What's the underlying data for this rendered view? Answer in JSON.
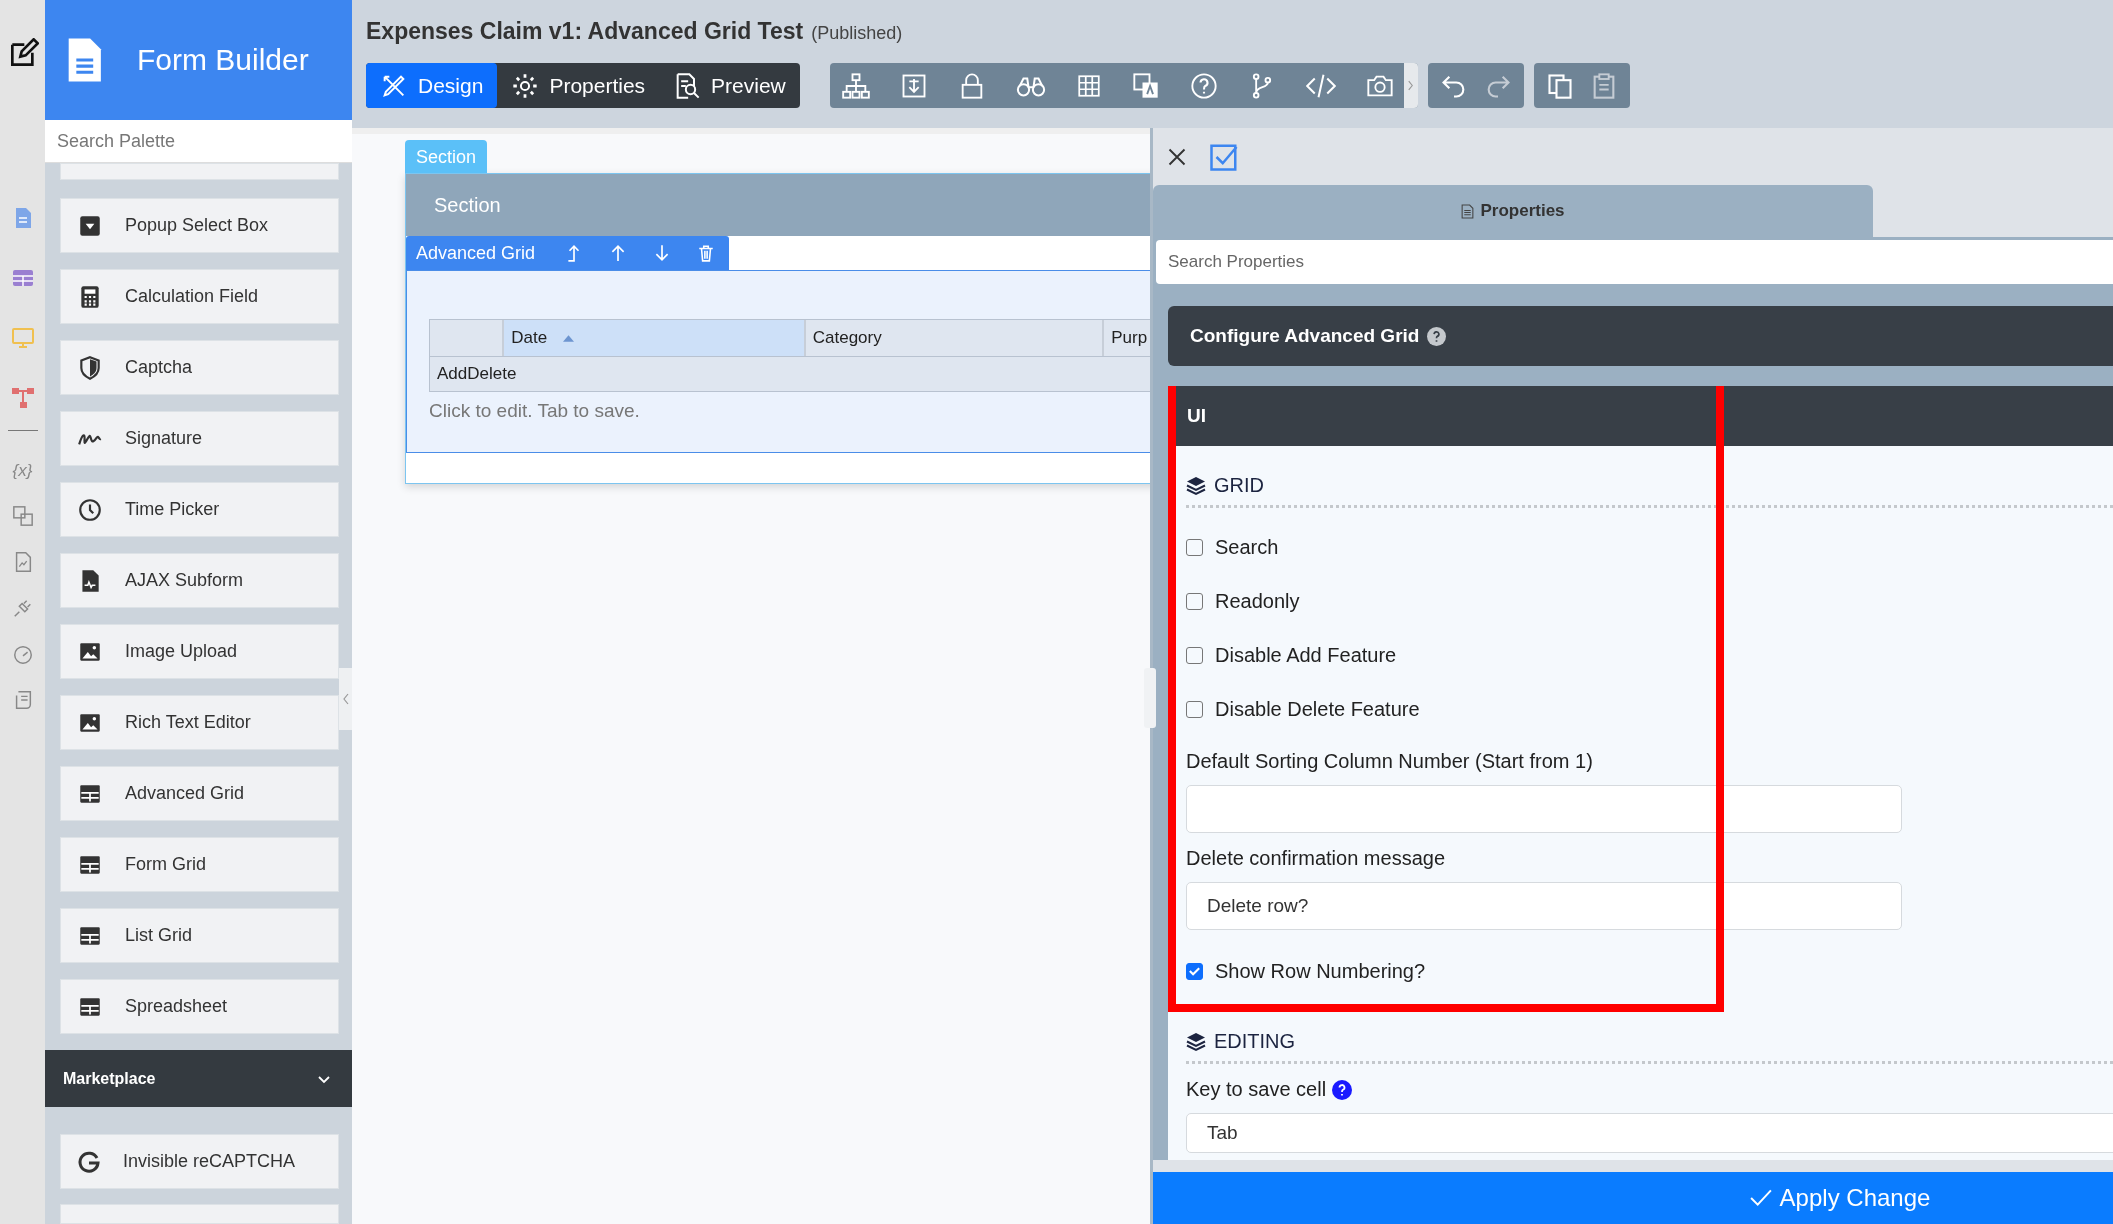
{
  "rail": {
    "variable_glyph": "{x}"
  },
  "palette": {
    "title": "Form Builder",
    "search": {
      "placeholder": "Search Palette"
    },
    "items": [
      {
        "label": "Popup Select Box"
      },
      {
        "label": "Calculation Field"
      },
      {
        "label": "Captcha"
      },
      {
        "label": "Signature"
      },
      {
        "label": "Time Picker"
      },
      {
        "label": "AJAX Subform"
      },
      {
        "label": "Image Upload"
      },
      {
        "label": "Rich Text Editor"
      },
      {
        "label": "Advanced Grid"
      },
      {
        "label": "Form Grid"
      },
      {
        "label": "List Grid"
      },
      {
        "label": "Spreadsheet"
      }
    ],
    "marketplace": {
      "label": "Marketplace",
      "expanded": true,
      "items": [
        {
          "label": "Invisible reCAPTCHA"
        }
      ]
    }
  },
  "header": {
    "title": "Expenses Claim v1: Advanced Grid Test",
    "status": "(Published)"
  },
  "modes": [
    {
      "label": "Design",
      "selected": true
    },
    {
      "label": "Properties",
      "selected": false
    },
    {
      "label": "Preview",
      "selected": false
    }
  ],
  "canvas": {
    "section_tab": "Section",
    "section_title": "Section",
    "element_label": "Advanced Grid",
    "grid": {
      "columns": [
        {
          "sorted": false
        },
        {
          "label": "Date",
          "sorted": true
        },
        {
          "label": "Category",
          "sorted": false
        },
        {
          "label": "Purp",
          "sorted": false
        }
      ],
      "row": "AddDelete",
      "hint": "Click to edit. Tab to save."
    }
  },
  "panel": {
    "tabs": [
      {
        "label": "Properties",
        "selected": true
      }
    ],
    "search": {
      "placeholder": "Search Properties"
    },
    "heading": "Configure Advanced Grid",
    "section": "UI",
    "groups": [
      {
        "title": "GRID",
        "highlighted": true,
        "fields": [
          {
            "kind": "checkbox",
            "label": "Search",
            "checked": false
          },
          {
            "kind": "checkbox",
            "label": "Readonly",
            "checked": false
          },
          {
            "kind": "checkbox",
            "label": "Disable Add Feature",
            "checked": false
          },
          {
            "kind": "checkbox",
            "label": "Disable Delete Feature",
            "checked": false
          },
          {
            "kind": "text",
            "label": "Default Sorting Column Number (Start from 1)"
          },
          {
            "kind": "text",
            "label": "Delete confirmation message",
            "value": "Delete row?"
          },
          {
            "kind": "checkbox",
            "label": "Show Row Numbering?",
            "checked": true
          }
        ]
      },
      {
        "title": "EDITING",
        "highlighted": false,
        "fields": [
          {
            "kind": "select",
            "label": "Key to save cell",
            "value": "Tab",
            "help": true
          }
        ]
      }
    ],
    "apply": "Apply Change"
  }
}
